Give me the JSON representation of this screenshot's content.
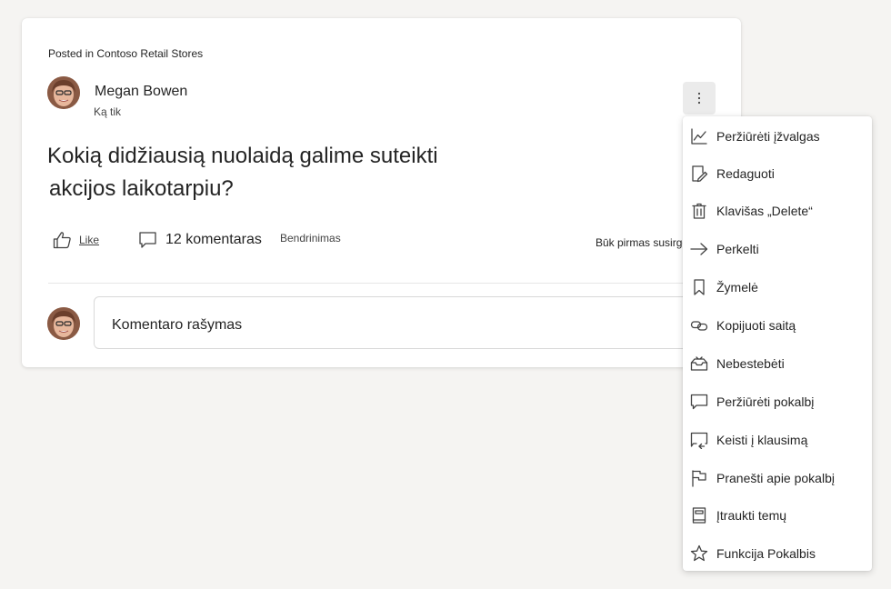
{
  "post": {
    "posted_in_prefix": "Posted in",
    "community": "Contoso Retail Stores",
    "author": "Megan Bowen",
    "timestamp": "Ką tik",
    "question_line1": "Kokią didžiausią nuolaidą galime suteikti",
    "question_line2": "akcijos laikotarpiu?"
  },
  "actions": {
    "like_label": "Like",
    "comments_label": "12 komentaras",
    "share_label": "Bendrinimas",
    "first_react": "Būk pirmas susirges"
  },
  "comment": {
    "placeholder": "Komentaro rašymas"
  },
  "menu": {
    "items": [
      {
        "label": "Peržiūrėti įžvalgas",
        "icon": "chart-line-icon"
      },
      {
        "label": "Redaguoti",
        "icon": "edit-icon"
      },
      {
        "label": "Klavišas „Delete“",
        "icon": "trash-icon"
      },
      {
        "label": "Perkelti",
        "icon": "arrow-right-icon"
      },
      {
        "label": "Žymelė",
        "icon": "bookmark-icon"
      },
      {
        "label": "Kopijuoti saitą",
        "icon": "link-icon"
      },
      {
        "label": "Nebestebėti",
        "icon": "mail-inbox-icon"
      },
      {
        "label": "Peržiūrėti pokalbį",
        "icon": "chat-bubble-icon"
      },
      {
        "label": "Keisti į klausimą",
        "icon": "chat-arrow-icon"
      },
      {
        "label": "Pranešti apie pokalbį",
        "icon": "flag-icon"
      },
      {
        "label": "Įtraukti temų",
        "icon": "book-icon"
      },
      {
        "label": "Funkcija Pokalbis",
        "icon": "star-icon"
      }
    ]
  }
}
